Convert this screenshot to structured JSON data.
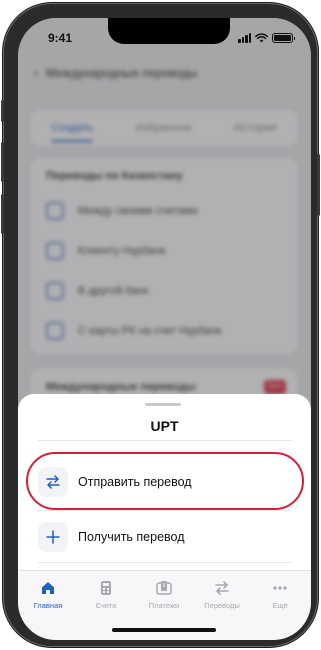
{
  "status_bar": {
    "time": "9:41"
  },
  "background": {
    "header_title": "Международные переводы",
    "tabs": [
      {
        "label": "Создать",
        "active": true
      },
      {
        "label": "Избранное",
        "active": false
      },
      {
        "label": "История",
        "active": false
      }
    ],
    "section_title": "Переводы по Казахстану",
    "items": [
      {
        "label": "Между своими счетами"
      },
      {
        "label": "Клиенту Нурбанк"
      },
      {
        "label": "В другой банк"
      },
      {
        "label": "С карты РК на счет Нурбанк"
      }
    ],
    "intl_title": "Международные переводы",
    "intl_badge": "New"
  },
  "sheet": {
    "title": "UPT",
    "options": [
      {
        "label": "Отправить перевод",
        "icon": "transfer-arrows-icon",
        "highlighted": true
      },
      {
        "label": "Получить перевод",
        "icon": "plus-icon",
        "highlighted": false
      }
    ]
  },
  "tabbar": {
    "items": [
      {
        "label": "Главная",
        "icon": "home-icon",
        "active": true
      },
      {
        "label": "Счета",
        "icon": "calculator-icon",
        "active": false
      },
      {
        "label": "Платежи",
        "icon": "payments-icon",
        "active": false
      },
      {
        "label": "Переводы",
        "icon": "transfer-icon",
        "active": false
      },
      {
        "label": "Ещё",
        "icon": "more-icon",
        "active": false
      }
    ]
  },
  "colors": {
    "accent": "#1f5fbf",
    "highlight_ring": "#d81e3a",
    "inactive": "#a8a8ae"
  }
}
